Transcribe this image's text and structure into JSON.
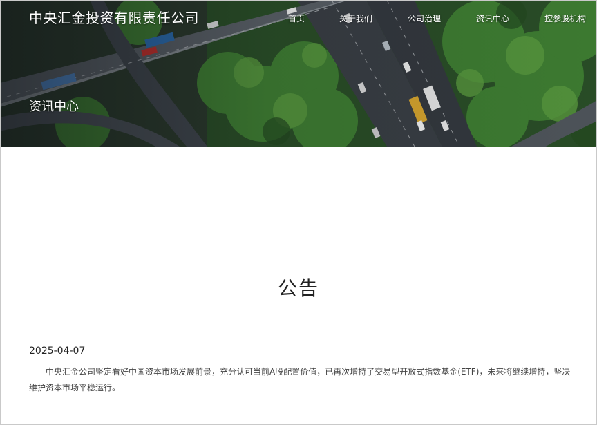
{
  "header": {
    "brand": "中央汇金投资有限责任公司",
    "nav": [
      {
        "label": "首页"
      },
      {
        "label": "关于我们"
      },
      {
        "label": "公司治理"
      },
      {
        "label": "资讯中心"
      },
      {
        "label": "控参股机构"
      }
    ]
  },
  "banner": {
    "section_title": "资讯中心",
    "image_subject": "aerial-highway-interchange-with-trees"
  },
  "notice": {
    "title": "公告",
    "date": "2025-04-07",
    "body": "中央汇金公司坚定看好中国资本市场发展前景，充分认可当前A股配置价值，已再次增持了交易型开放式指数基金(ETF)，未来将继续增持，坚决维护资本市场平稳运行。"
  },
  "colors": {
    "banner_text": "#ffffff",
    "title_text": "#222222",
    "body_text": "#444444",
    "foliage": "#2f6a2a",
    "road": "#3a3f45"
  }
}
